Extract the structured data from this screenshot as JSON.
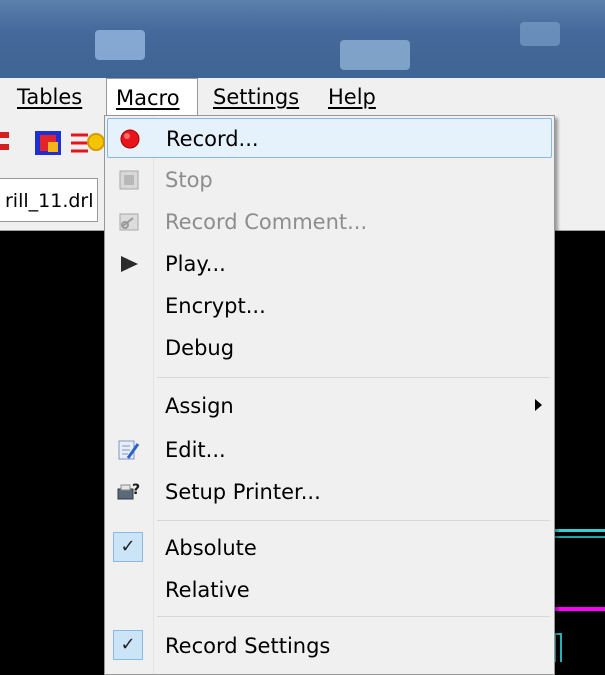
{
  "menubar": {
    "tables": "Tables",
    "macro": "Macro",
    "settings": "Settings",
    "help": "Help"
  },
  "tab": {
    "file": "rill_11.drl"
  },
  "menu": {
    "record": "Record...",
    "stop": "Stop",
    "record_comment": "Record Comment...",
    "play": "Play...",
    "encrypt": "Encrypt...",
    "debug": "Debug",
    "assign": "Assign",
    "edit": "Edit...",
    "setup_printer": "Setup Printer...",
    "absolute": "Absolute",
    "relative": "Relative",
    "record_settings": "Record Settings",
    "absolute_checked": true,
    "record_settings_checked": true
  },
  "colors": {
    "record_dot": "#e8141c",
    "highlight_bg": "#e5f1fb",
    "highlight_border": "#86b7ea",
    "trace_cyan": "#32d2d2",
    "trace_magenta": "#ff00ff"
  },
  "icons": {
    "record": "record-icon",
    "stop": "stop-icon",
    "record_comment": "record-comment-icon",
    "play": "play-icon",
    "edit": "edit-icon",
    "setup_printer": "printer-icon",
    "checkmark": "checkmark-icon",
    "submenu": "submenu-arrow-icon"
  }
}
